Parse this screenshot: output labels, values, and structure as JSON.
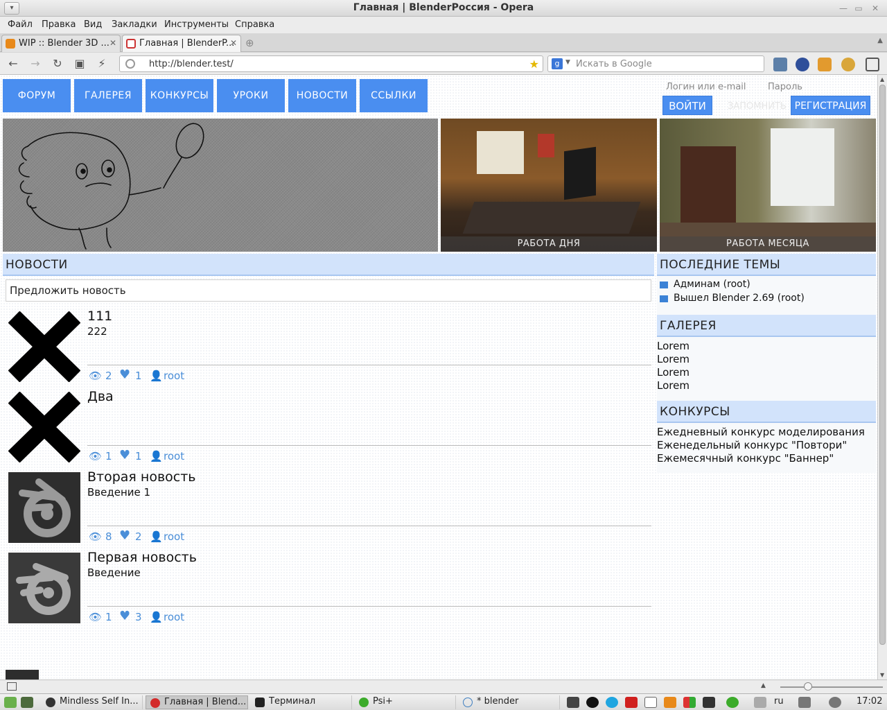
{
  "window": {
    "title": "Главная | BlenderРоссия - Opera"
  },
  "menu": {
    "items": [
      "Файл",
      "Правка",
      "Вид",
      "Закладки",
      "Инструменты",
      "Справка"
    ]
  },
  "tabs": [
    {
      "label": "WIP :: Blender 3D ...",
      "active": false
    },
    {
      "label": "Главная | BlenderP...",
      "active": true
    }
  ],
  "address": {
    "url": "http://blender.test/",
    "search_placeholder": "Искать в Google"
  },
  "site": {
    "nav": [
      "ФОРУМ",
      "ГАЛЕРЕЯ",
      "КОНКУРСЫ",
      "УРОКИ",
      "НОВОСТИ",
      "ССЫЛКИ"
    ],
    "login": {
      "login_label": "Логин или e-mail",
      "password_label": "Пароль",
      "login_button": "ВОЙТИ",
      "remember": "ЗАПОМНИТЬ",
      "register_button": "РЕГИСТРАЦИЯ"
    },
    "hero": {
      "work_day": "РАБОТА ДНЯ",
      "work_month": "РАБОТА МЕСЯЦА"
    },
    "news_heading": "НОВОСТИ",
    "suggest": "Предложить новость",
    "news": [
      {
        "title": "111",
        "intro": "222",
        "views": "2",
        "likes": "1",
        "author": "root",
        "thumb": "x-icon"
      },
      {
        "title": "Два",
        "intro": "",
        "views": "1",
        "likes": "1",
        "author": "root",
        "thumb": "x-icon"
      },
      {
        "title": "Вторая новость",
        "intro": "Введение 1",
        "views": "8",
        "likes": "2",
        "author": "root",
        "thumb": "blender-logo"
      },
      {
        "title": "Первая новость",
        "intro": "Введение",
        "views": "1",
        "likes": "3",
        "author": "root",
        "thumb": "blender-logo"
      }
    ],
    "sidebar": {
      "topics_heading": "ПОСЛЕДНИЕ ТЕМЫ",
      "topics": [
        "Админам (root)",
        "Вышел Blender 2.69 (root)"
      ],
      "gallery_heading": "ГАЛЕРЕЯ",
      "gallery": [
        "Lorem",
        "Lorem",
        "Lorem",
        "Lorem"
      ],
      "contests_heading": "КОНКУРСЫ",
      "contests": [
        "Ежедневный конкурс моделирования",
        "Еженедельный конкурс \"Повтори\"",
        "Ежемесячный конкурс \"Баннер\""
      ]
    }
  },
  "taskbar": {
    "tasks": [
      "Mindless Self In...",
      "Главная | Blend...",
      "Терминал",
      "Psi+",
      "* blender"
    ],
    "lang": "ru",
    "time": "17:02"
  },
  "colors": {
    "accent": "#4a8ef0",
    "section_bg": "#d2e3fb",
    "meta": "#4a8ed8"
  }
}
